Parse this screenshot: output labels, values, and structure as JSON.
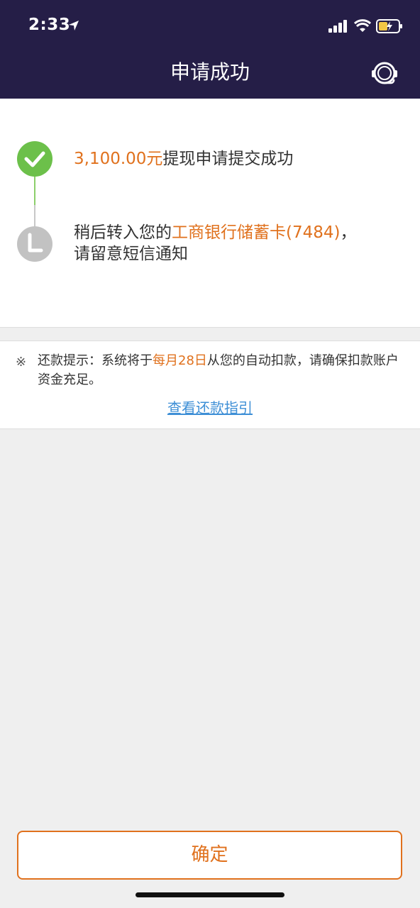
{
  "status_bar": {
    "time": "2:33"
  },
  "header": {
    "title": "申请成功"
  },
  "steps": {
    "step1": {
      "amount": "3,100.00元",
      "text": "提现申请提交成功"
    },
    "step2": {
      "prefix": "稍后转入您的",
      "card": "工商银行储蓄卡(7484)",
      "suffix": "，",
      "line2": "请留意短信通知"
    }
  },
  "notice": {
    "mark": "※",
    "label": "还款提示：",
    "text1": "系统将于",
    "date": "每月28日",
    "text2": "从您的自动扣款，请确保扣款账户资金充足。",
    "link": "查看还款指引"
  },
  "confirm_label": "确定",
  "colors": {
    "accent": "#e0711d",
    "header_bg": "#251e47",
    "success": "#6cc04a",
    "pending": "#c2c2c2",
    "link": "#3e8fd6"
  }
}
